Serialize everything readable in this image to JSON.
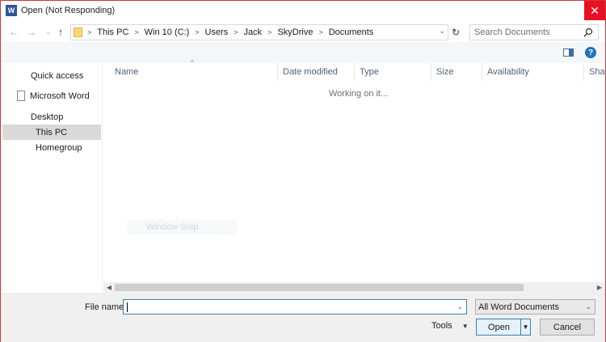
{
  "window": {
    "title": "Open (Not Responding)",
    "app_icon_letter": "W",
    "close_glyph": "✕",
    "accent_color": "#e81123"
  },
  "nav": {
    "back_glyph": "←",
    "forward_glyph": "→",
    "up_glyph": "↑",
    "breadcrumbs": [
      "This PC",
      "Win 10 (C:)",
      "Users",
      "Jack",
      "SkyDrive",
      "Documents"
    ],
    "refresh_glyph": "↻",
    "search_placeholder": "Search Documents"
  },
  "toolbar": {
    "help_glyph": "?"
  },
  "sidebar": {
    "items": [
      {
        "label": "Quick access"
      },
      {
        "label": "Microsoft Word"
      },
      {
        "label": "Desktop"
      },
      {
        "label": "This PC",
        "selected": true
      },
      {
        "label": "Homegroup"
      }
    ]
  },
  "columns": [
    "Name",
    "Date modified",
    "Type",
    "Size",
    "Availability",
    "Shar"
  ],
  "content": {
    "status_text": "Working on it...",
    "ghost_text": "Window Snip"
  },
  "footer": {
    "file_name_label": "File name:",
    "file_name_value": "",
    "filter_value": "All Word Documents",
    "tools_label": "Tools",
    "open_label": "Open",
    "cancel_label": "Cancel"
  }
}
